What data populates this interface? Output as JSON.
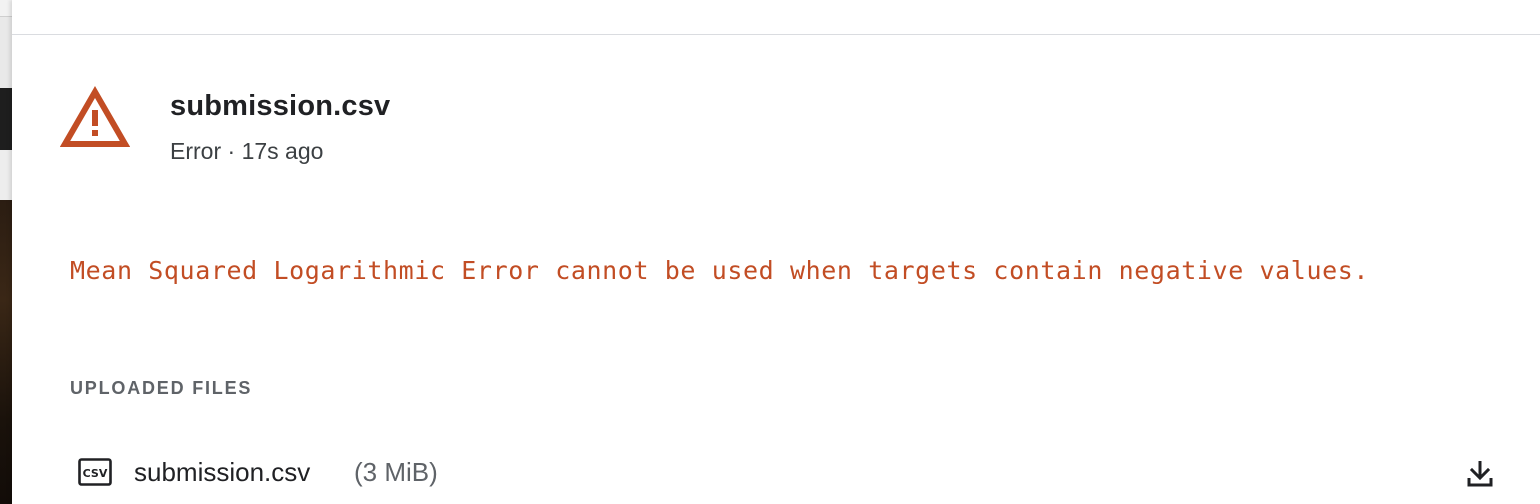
{
  "submission": {
    "file_name": "submission.csv",
    "status": "Error",
    "separator": " · ",
    "time_ago": "17s ago",
    "error_message": "Mean Squared Logarithmic Error cannot be used when targets contain negative values."
  },
  "uploaded_files": {
    "heading": "UPLOADED FILES",
    "items": [
      {
        "icon": "csv-file-icon",
        "icon_text": "CSV",
        "name": "submission.csv",
        "size": "(3 MiB)",
        "action_icon": "download-icon"
      }
    ]
  },
  "colors": {
    "error": "#c24d24",
    "title": "#202124",
    "muted": "#5f6368"
  }
}
